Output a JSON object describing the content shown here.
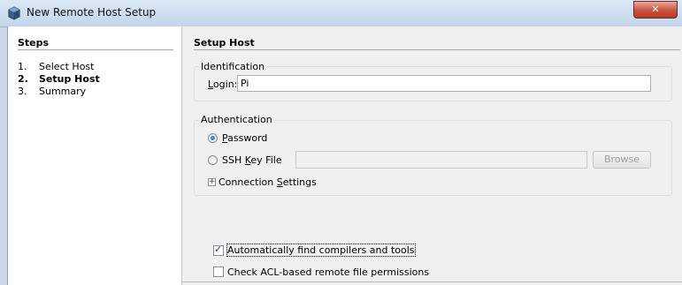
{
  "window": {
    "title": "New Remote Host Setup",
    "close_glyph": "✕"
  },
  "steps": {
    "title": "Steps",
    "items": [
      {
        "num": "1.",
        "label": "Select Host"
      },
      {
        "num": "2.",
        "label": "Setup Host"
      },
      {
        "num": "3.",
        "label": "Summary"
      }
    ]
  },
  "main": {
    "title": "Setup Host",
    "identification": {
      "legend": "Identification",
      "login_label": "Login:",
      "login_value": "Pi"
    },
    "authentication": {
      "legend": "Authentication",
      "password_label": "Password",
      "password_selected": true,
      "sshkey_label": "SSH Key File",
      "sshkey_value": "",
      "browse_label": "Browse",
      "connection_settings_label": "Connection Settings",
      "expander_glyph": "+"
    },
    "auto_find_label": "Automatically find compilers and tools",
    "auto_find_checked": true,
    "acl_label": "Check ACL-based remote file permissions",
    "acl_checked": false
  },
  "icons": {
    "app": "cube-icon",
    "check": "✓"
  }
}
